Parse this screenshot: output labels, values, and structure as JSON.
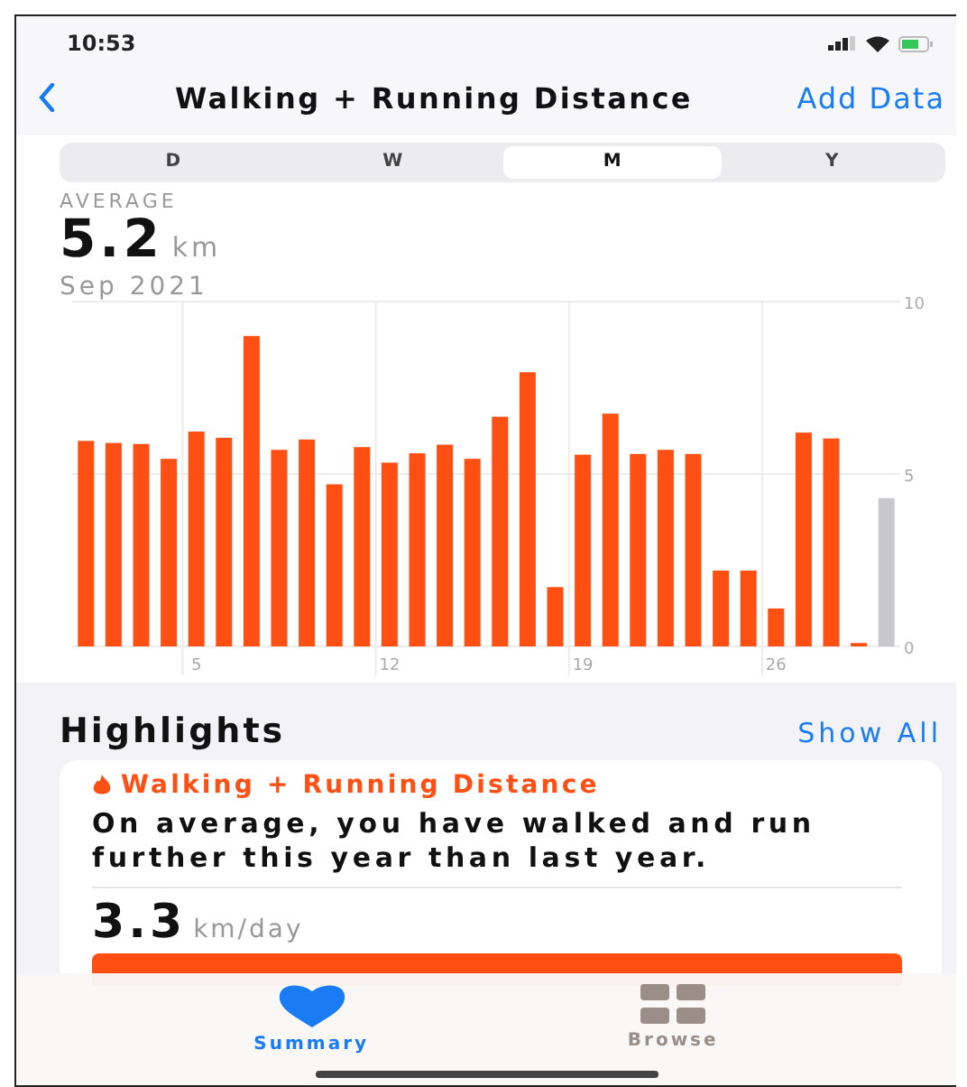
{
  "status_bar": {
    "time": "10:53"
  },
  "nav": {
    "title": "Walking + Running Distance",
    "action": "Add Data"
  },
  "segments": [
    {
      "label": "D",
      "selected": false
    },
    {
      "label": "W",
      "selected": false
    },
    {
      "label": "M",
      "selected": true
    },
    {
      "label": "Y",
      "selected": false
    }
  ],
  "summary": {
    "label": "AVERAGE",
    "value": "5.2",
    "unit": "km",
    "period": "Sep 2021"
  },
  "chart_data": {
    "type": "bar",
    "x": [
      1,
      2,
      3,
      4,
      5,
      6,
      7,
      8,
      9,
      10,
      11,
      12,
      13,
      14,
      15,
      16,
      17,
      18,
      19,
      20,
      21,
      22,
      23,
      24,
      25,
      26,
      27,
      28,
      29,
      30
    ],
    "xlim": [
      0.5,
      30.5
    ],
    "xticks": [
      5,
      12,
      19,
      26
    ],
    "ylim": [
      0,
      10
    ],
    "yticks": [
      0,
      5,
      10
    ],
    "series": [
      {
        "color": "#ff4f12",
        "values": [
          5.96,
          5.9,
          5.87,
          5.44,
          6.23,
          6.05,
          9.0,
          5.7,
          6.0,
          4.7,
          5.78,
          5.33,
          5.6,
          5.85,
          5.44,
          6.66,
          7.95,
          1.72,
          5.56,
          6.75,
          5.58,
          5.7,
          5.58,
          2.2,
          2.2,
          1.1,
          6.2,
          6.03,
          0.1,
          null
        ]
      },
      {
        "color": "#c7c7cc",
        "values": [
          null,
          null,
          null,
          null,
          null,
          null,
          null,
          null,
          null,
          null,
          null,
          null,
          null,
          null,
          null,
          null,
          null,
          null,
          null,
          null,
          null,
          null,
          null,
          null,
          null,
          null,
          null,
          null,
          null,
          4.3
        ]
      }
    ]
  },
  "highlights": {
    "heading": "Highlights",
    "show_all": "Show All",
    "card": {
      "title": "Walking + Running Distance",
      "text": "On average, you have walked and run further this year than last year.",
      "value": "3.3",
      "unit": "km/day"
    }
  },
  "tab_bar": [
    {
      "label": "Summary",
      "kind": "summary",
      "selected": true
    },
    {
      "label": "Browse",
      "kind": "browse",
      "selected": false
    }
  ]
}
